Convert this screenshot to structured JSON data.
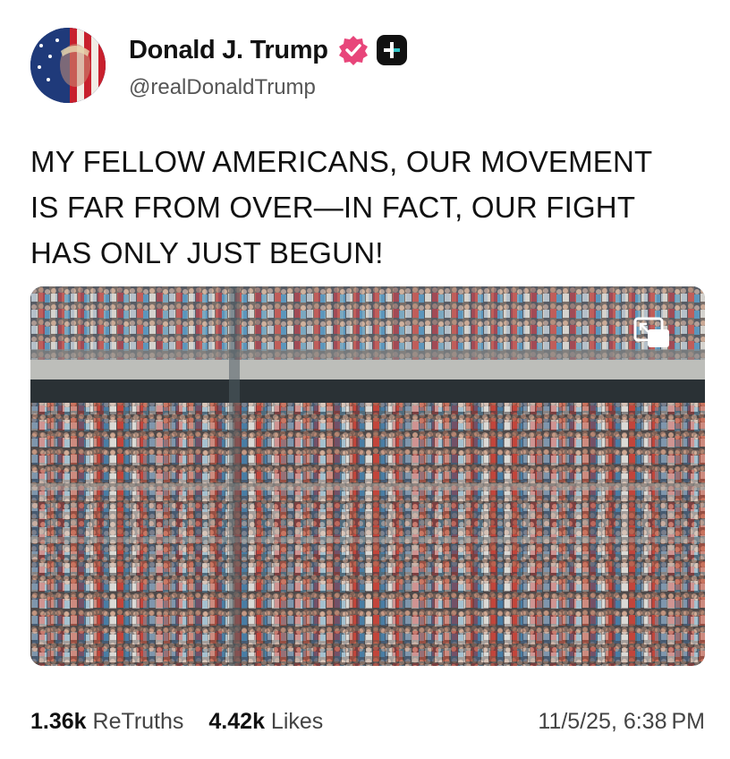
{
  "author": {
    "display_name": "Donald J. Trump",
    "handle": "@realDonaldTrump",
    "verified_badge_color": "#e8457a"
  },
  "post": {
    "text": "MY FELLOW AMERICANS, OUR MOVEMENT\nIS FAR FROM OVER—IN FACT, OUR FIGHT\nHAS ONLY JUST BEGUN!"
  },
  "media": {
    "type": "video",
    "control_icon": "picture-in-picture-icon"
  },
  "stats": {
    "retruths_count": "1.36k",
    "retruths_label": "ReTruths",
    "likes_count": "4.42k",
    "likes_label": "Likes",
    "timestamp": "11/5/25, 6:38 PM"
  }
}
